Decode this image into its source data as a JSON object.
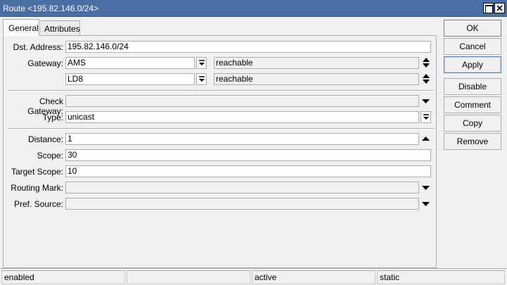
{
  "window": {
    "title": "Route <195.82.146.0/24>"
  },
  "tabs": [
    {
      "label": "General"
    },
    {
      "label": "Attributes"
    }
  ],
  "form": {
    "dst_address": {
      "label": "Dst. Address:",
      "value": "195.82.146.0/24"
    },
    "gateway": {
      "label": "Gateway:",
      "entries": [
        {
          "value": "AMS",
          "status": "reachable"
        },
        {
          "value": "LD8",
          "status": "reachable"
        }
      ]
    },
    "check_gateway": {
      "label": "Check Gateway:",
      "value": ""
    },
    "type": {
      "label": "Type:",
      "value": "unicast"
    },
    "distance": {
      "label": "Distance:",
      "value": "1"
    },
    "scope": {
      "label": "Scope:",
      "value": "30"
    },
    "target_scope": {
      "label": "Target Scope:",
      "value": "10"
    },
    "routing_mark": {
      "label": "Routing Mark:",
      "value": ""
    },
    "pref_source": {
      "label": "Pref. Source:",
      "value": ""
    }
  },
  "buttons": {
    "ok": "OK",
    "cancel": "Cancel",
    "apply": "Apply",
    "disable": "Disable",
    "comment": "Comment",
    "copy": "Copy",
    "remove": "Remove"
  },
  "status": {
    "state": "enabled",
    "cell2": "",
    "active": "active",
    "static": "static"
  }
}
